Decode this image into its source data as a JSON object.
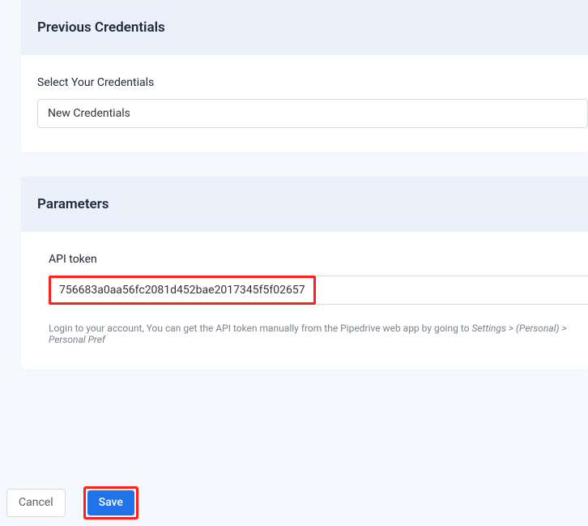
{
  "credentialsPanel": {
    "title": "Previous Credentials",
    "selectLabel": "Select Your Credentials",
    "selectedValue": "New Credentials"
  },
  "parametersPanel": {
    "title": "Parameters",
    "apiTokenLabel": "API token",
    "apiTokenValue": "756683a0aa56fc2081d452bae2017345f5f02657",
    "hintPrefix": "Login to your account, You can get the API token manually from the Pipedrive web app by going to ",
    "hintPath": "Settings > (Personal) > Personal Pref"
  },
  "actions": {
    "cancelLabel": "Cancel",
    "saveLabel": "Save"
  }
}
